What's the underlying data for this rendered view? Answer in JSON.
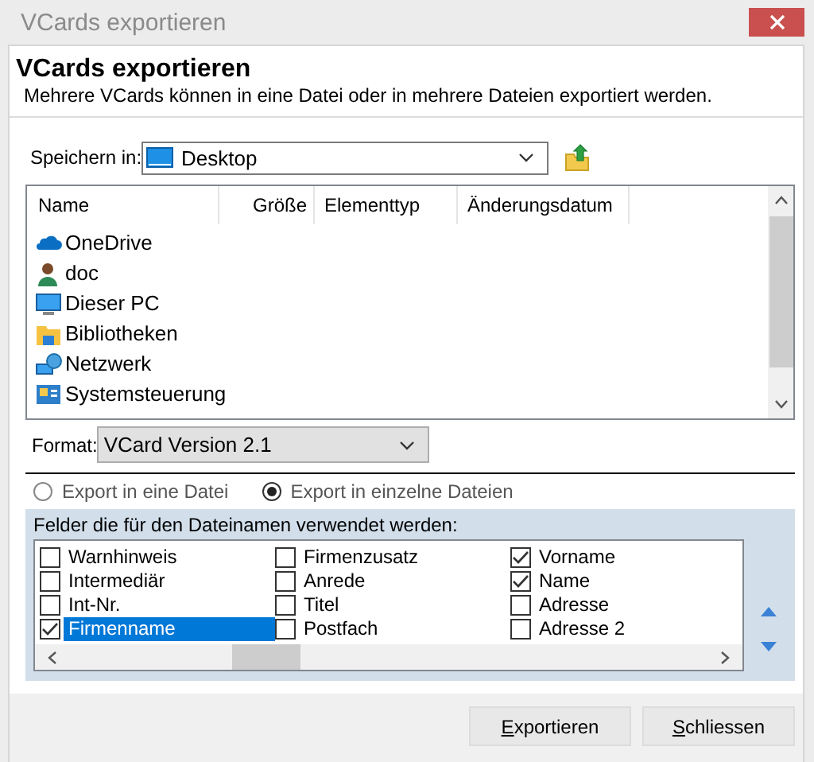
{
  "window": {
    "title": "VCards exportieren"
  },
  "header": {
    "title": "VCards exportieren",
    "description": "Mehrere VCards können in eine Datei oder in mehrere Dateien exportiert werden."
  },
  "save_in": {
    "label": "Speichern in:",
    "value": "Desktop"
  },
  "file_list": {
    "columns": [
      "Name",
      "Größe",
      "Elementtyp",
      "Änderungsdatum"
    ],
    "items": [
      {
        "name": "OneDrive",
        "kind": "cloud"
      },
      {
        "name": "doc",
        "kind": "user"
      },
      {
        "name": "Dieser PC",
        "kind": "pc"
      },
      {
        "name": "Bibliotheken",
        "kind": "library"
      },
      {
        "name": "Netzwerk",
        "kind": "network"
      },
      {
        "name": "Systemsteuerung",
        "kind": "control-panel"
      }
    ]
  },
  "format": {
    "label": "Format:",
    "value": "VCard Version 2.1"
  },
  "export_mode": [
    {
      "label": "Export in eine Datei",
      "selected": false
    },
    {
      "label": "Export in einzelne Dateien",
      "selected": true
    }
  ],
  "fields": {
    "label": "Felder die für den Dateinamen verwendet werden:",
    "items": [
      {
        "label": "Warnhinweis",
        "checked": false,
        "selected": false
      },
      {
        "label": "Intermediär",
        "checked": false,
        "selected": false
      },
      {
        "label": "Int-Nr.",
        "checked": false,
        "selected": false
      },
      {
        "label": "Firmenname",
        "checked": true,
        "selected": true
      },
      {
        "label": "Firmenzusatz",
        "checked": false,
        "selected": false
      },
      {
        "label": "Anrede",
        "checked": false,
        "selected": false
      },
      {
        "label": "Titel",
        "checked": false,
        "selected": false
      },
      {
        "label": "Postfach",
        "checked": false,
        "selected": false
      },
      {
        "label": "Vorname",
        "checked": true,
        "selected": false
      },
      {
        "label": "Name",
        "checked": true,
        "selected": false
      },
      {
        "label": "Adresse",
        "checked": false,
        "selected": false
      },
      {
        "label": "Adresse 2",
        "checked": false,
        "selected": false
      }
    ]
  },
  "buttons": [
    "Exportieren",
    "Schliessen"
  ]
}
